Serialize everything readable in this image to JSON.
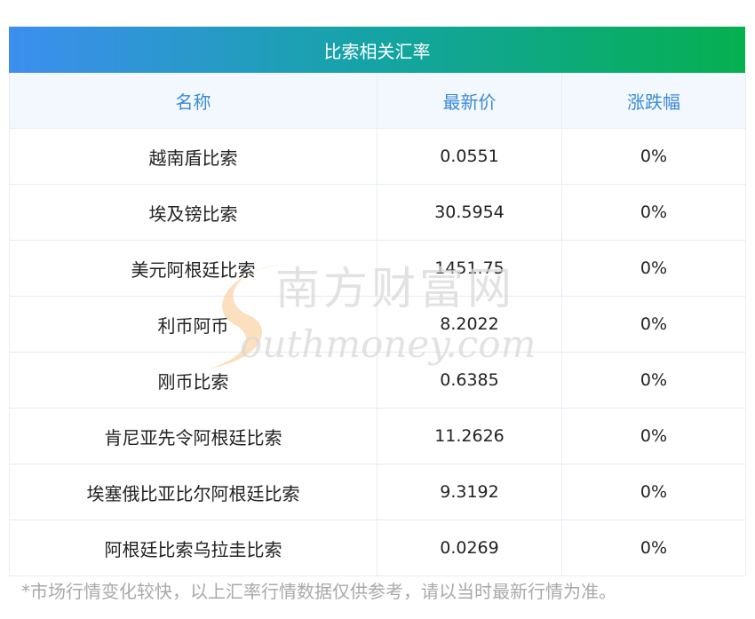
{
  "table": {
    "title": "比索相关汇率",
    "headers": [
      "名称",
      "最新价",
      "涨跌幅"
    ],
    "rows": [
      {
        "name": "越南盾比索",
        "price": "0.0551",
        "change": "0%"
      },
      {
        "name": "埃及镑比索",
        "price": "30.5954",
        "change": "0%"
      },
      {
        "name": "美元阿根廷比索",
        "price": "1451.75",
        "change": "0%"
      },
      {
        "name": "利币阿币",
        "price": "8.2022",
        "change": "0%"
      },
      {
        "name": "刚币比索",
        "price": "0.6385",
        "change": "0%"
      },
      {
        "name": "肯尼亚先令阿根廷比索",
        "price": "11.2626",
        "change": "0%"
      },
      {
        "name": "埃塞俄比亚比尔阿根廷比索",
        "price": "9.3192",
        "change": "0%"
      },
      {
        "name": "阿根廷比索乌拉圭比索",
        "price": "0.0269",
        "change": "0%"
      }
    ]
  },
  "footnote": "*市场行情变化较快，以上汇率行情数据仅供参考，请以当时最新行情为准。",
  "watermark": {
    "cn": "南方财富网",
    "en": "outhmoney.com"
  }
}
